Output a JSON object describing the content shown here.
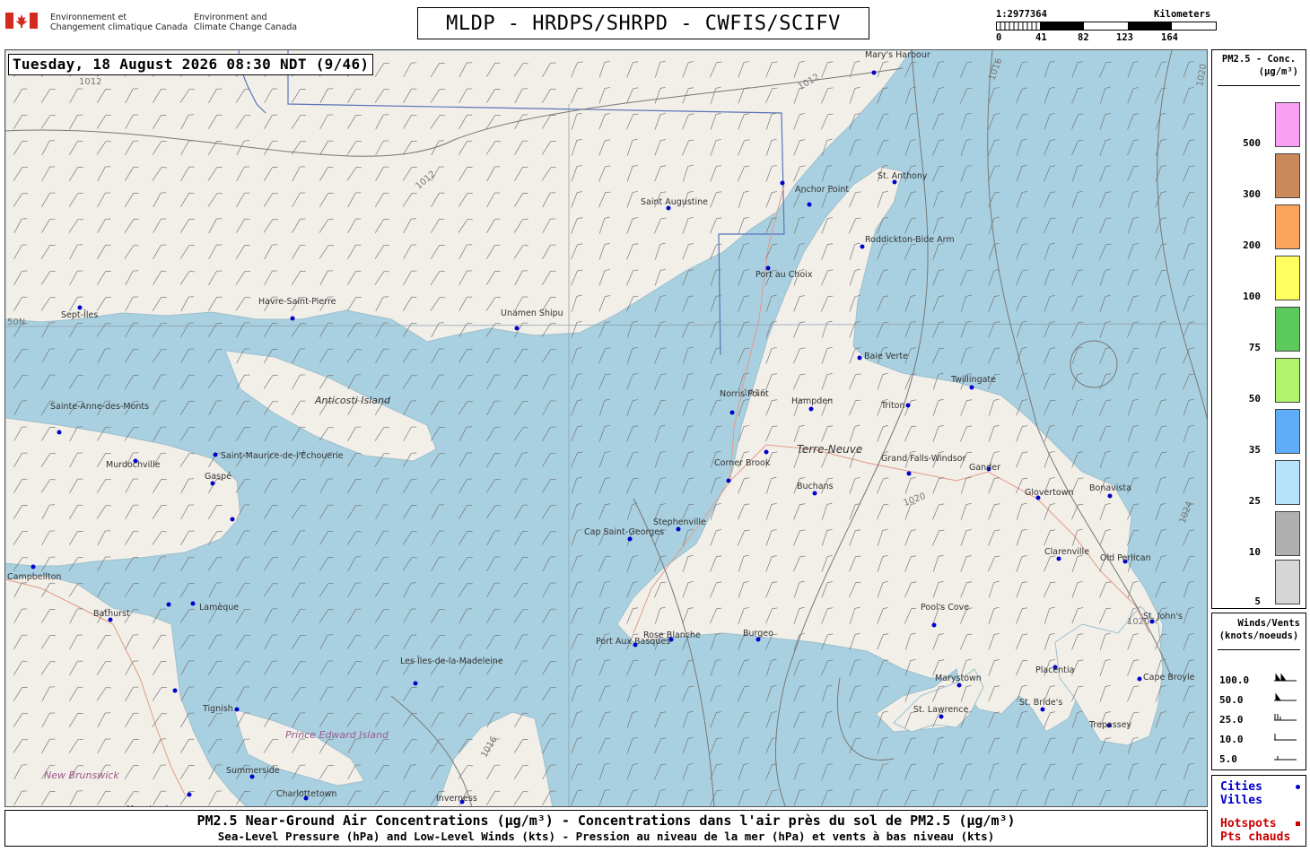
{
  "header": {
    "org_line1_fr": "Environnement et",
    "org_line2_fr": "Changement climatique Canada",
    "org_line1_en": "Environment and",
    "org_line2_en": "Climate Change Canada",
    "title": "MLDP - HRDPS/SHRPD - CWFIS/SCIFV"
  },
  "scale": {
    "ratio": "1:2977364",
    "unit": "Kilometers",
    "ticks": [
      "0",
      "41",
      "82",
      "123",
      "164"
    ]
  },
  "map": {
    "timestamp": "Tuesday, 18 August 2026 08:30 NDT (9/46)",
    "region_labels": [
      "Anticosti Island",
      "Terre-Neuve",
      "Prince Edward Island",
      "New Brunswick"
    ],
    "isobar_labels": [
      "1012",
      "1012",
      "1012",
      "1016",
      "1016",
      "1016",
      "1020",
      "1020",
      "1024",
      "1020"
    ],
    "latitude_label": "50N",
    "places": [
      {
        "name": "Mary's Harbour"
      },
      {
        "name": "St. Anthony"
      },
      {
        "name": "Anchor Point"
      },
      {
        "name": "Saint Augustine"
      },
      {
        "name": "Roddickton-Bide Arm"
      },
      {
        "name": "Port au Choix"
      },
      {
        "name": "Havre-Saint-Pierre"
      },
      {
        "name": "Unamen Shipu"
      },
      {
        "name": "Sept-Îles"
      },
      {
        "name": "Baie Verte"
      },
      {
        "name": "Twillingate"
      },
      {
        "name": "Norris Point"
      },
      {
        "name": "Hampden"
      },
      {
        "name": "Triton"
      },
      {
        "name": "Sainte-Anne-des-Monts"
      },
      {
        "name": "Murdochville"
      },
      {
        "name": "Saint-Maurice-de-l'Échouerie"
      },
      {
        "name": "Gaspé"
      },
      {
        "name": "Corner Brook"
      },
      {
        "name": "Grand Falls-Windsor"
      },
      {
        "name": "Gander"
      },
      {
        "name": "Buchans"
      },
      {
        "name": "Glovertown"
      },
      {
        "name": "Bonavista"
      },
      {
        "name": "Stephenville"
      },
      {
        "name": "Cap Saint-Georges"
      },
      {
        "name": "Clarenville"
      },
      {
        "name": "Old Perlican"
      },
      {
        "name": "Campbellton"
      },
      {
        "name": "Bathurst"
      },
      {
        "name": "Lamèque"
      },
      {
        "name": "Pool's Cove"
      },
      {
        "name": "St. John's"
      },
      {
        "name": "Port Aux Basques"
      },
      {
        "name": "Rose Blanche"
      },
      {
        "name": "Burgeo"
      },
      {
        "name": "Les Îles-de-la-Madeleine"
      },
      {
        "name": "Marystown"
      },
      {
        "name": "Placentia"
      },
      {
        "name": "Cape Broyle"
      },
      {
        "name": "Tignish"
      },
      {
        "name": "St. Lawrence"
      },
      {
        "name": "St. Bride's"
      },
      {
        "name": "Trepassey"
      },
      {
        "name": "Summerside"
      },
      {
        "name": "Charlottetown"
      },
      {
        "name": "Inverness"
      },
      {
        "name": "Moncton"
      }
    ]
  },
  "legend": {
    "title_line1": "PM2.5 - Conc.",
    "title_line2": "(µg/m³)",
    "levels": [
      {
        "label": "500",
        "color": "#f9a0f5"
      },
      {
        "label": "300",
        "color": "#c9895a"
      },
      {
        "label": "200",
        "color": "#fba45c"
      },
      {
        "label": "100",
        "color": "#fefe60"
      },
      {
        "label": "75",
        "color": "#5bc95b"
      },
      {
        "label": "50",
        "color": "#b1f36a"
      },
      {
        "label": "35",
        "color": "#5fadf8"
      },
      {
        "label": "25",
        "color": "#b5e4fa"
      },
      {
        "label": "10",
        "color": "#b0b0b0"
      },
      {
        "label": "5",
        "color": "#d6d6d6"
      }
    ]
  },
  "winds_legend": {
    "title_line1": "Winds/Vents",
    "title_line2": "(knots/noeuds)",
    "rows": [
      "100.0",
      "50.0",
      "25.0",
      "10.0",
      "5.0"
    ]
  },
  "cities_legend": {
    "cities": "Cities",
    "villes": "Villes",
    "hotspots": "Hotspots",
    "pts_chauds": "Pts chauds",
    "city_color": "#0000cc",
    "hotspot_color": "#cc0000"
  },
  "footer": {
    "line1": "PM2.5 Near-Ground Air Concentrations (µg/m³) - Concentrations dans l'air près du sol de PM2.5 (µg/m³)",
    "line2": "Sea-Level Pressure (hPa) and Low-Level Winds (kts) - Pression au niveau de la mer (hPa) et vents à bas niveau (kts)"
  }
}
